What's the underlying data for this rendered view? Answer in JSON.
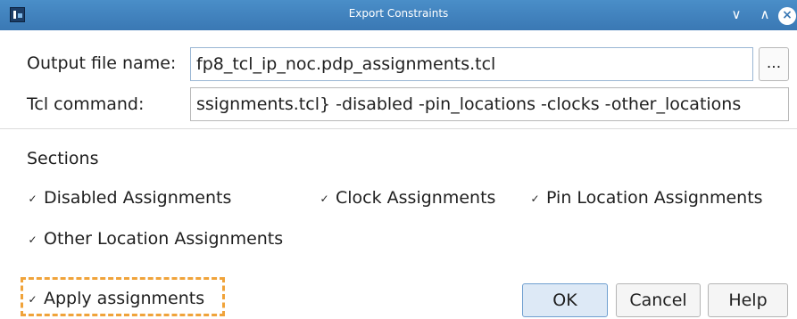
{
  "window": {
    "title": "Export Constraints",
    "icons": {
      "app": "quartus-app-icon",
      "minimize": "chevron-down-icon",
      "maximize": "chevron-up-icon",
      "close": "close-icon"
    },
    "minimize_glyph": "∨",
    "maximize_glyph": "∧",
    "close_glyph": "×"
  },
  "form": {
    "output_label": "Output file name:",
    "output_value": "fp8_tcl_ip_noc.pdp_assignments.tcl",
    "browse_label": "...",
    "tcl_label": "Tcl command:",
    "tcl_value": "ssignments.tcl} -disabled -pin_locations -clocks -other_locations"
  },
  "sections": {
    "heading": "Sections",
    "check_glyph": "✓",
    "items": [
      {
        "label": "Disabled Assignments",
        "checked": true
      },
      {
        "label": "Clock Assignments",
        "checked": true
      },
      {
        "label": "Pin Location Assignments",
        "checked": true
      },
      {
        "label": "Other Location Assignments",
        "checked": true
      }
    ]
  },
  "footer": {
    "apply": {
      "label": "Apply assignments",
      "checked": true
    },
    "ok_label": "OK",
    "cancel_label": "Cancel",
    "help_label": "Help"
  },
  "colors": {
    "titlebar": "#3a78b4",
    "focus_ring": "#f0a33a",
    "default_button": "#dde9f6"
  }
}
